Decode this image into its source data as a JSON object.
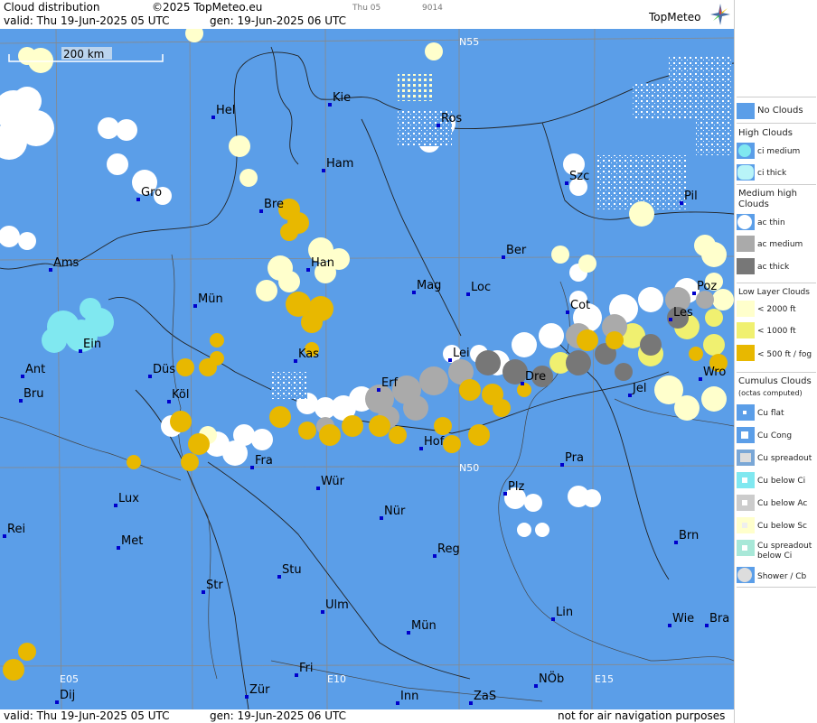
{
  "header": {
    "title": "Cloud distribution",
    "copyright": "©2025 TopMeteo.eu",
    "valid": "valid:  Thu  19-Jun-2025  05 UTC",
    "gen": "gen: 19-Jun-2025 06 UTC",
    "day_code": "Thu 05",
    "num_code": "9014",
    "logo": "TopMeteo"
  },
  "footer": {
    "valid": "valid:  Thu  19-Jun-2025  05 UTC",
    "gen": "gen: 19-Jun-2025 06 UTC",
    "disclaimer": "not for air navigation purposes"
  },
  "scale_bar": "200 km",
  "grid_labels": [
    "N55",
    "N50",
    "E05",
    "E10",
    "E15"
  ],
  "cities": [
    "Hel",
    "Kie",
    "Ros",
    "Ham",
    "Szc",
    "Gro",
    "Bre",
    "Pil",
    "Ams",
    "Han",
    "Ber",
    "Poz",
    "Mün",
    "Mag",
    "Loc",
    "Cot",
    "Les",
    "Ein",
    "Lei",
    "Ant",
    "Düs",
    "Kas",
    "Dre",
    "Wro",
    "Bru",
    "Köl",
    "Erf",
    "Jel",
    "Hof",
    "Fra",
    "Pra",
    "Würz",
    "Plz",
    "Lux",
    "Nür",
    "Rei",
    "Met",
    "Reg",
    "Brn",
    "Stu",
    "Str",
    "Ulm",
    "Lin",
    "Wie",
    "Bra",
    "Mün2",
    "Fri",
    "Dij",
    "Zür",
    "Inn",
    "ZaS",
    "NÖb"
  ],
  "city_names": {
    "Hel": "Hel",
    "Kie": "Kie",
    "Ros": "Ros",
    "Ham": "Ham",
    "Szc": "Szc",
    "Gro": "Gro",
    "Bre": "Bre",
    "Pil": "Pil",
    "Ams": "Ams",
    "Han": "Han",
    "Ber": "Ber",
    "Poz": "Poz",
    "Mün": "Mün",
    "Mag": "Mag",
    "Loc": "Loc",
    "Cot": "Cot",
    "Les": "Les",
    "Ein": "Ein",
    "Lei": "Lei",
    "Ant": "Ant",
    "Düs": "Düs",
    "Kas": "Kas",
    "Dre": "Dre",
    "Wro": "Wro",
    "Bru": "Bru",
    "Köl": "Köl",
    "Erf": "Erf",
    "Jel": "Jel",
    "Hof": "Hof",
    "Fra": "Fra",
    "Pra": "Pra",
    "Würz": "Wür",
    "Plz": "Plz",
    "Lux": "Lux",
    "Nür": "Nür",
    "Rei": "Rei",
    "Met": "Met",
    "Reg": "Reg",
    "Brn": "Brn",
    "Stu": "Stu",
    "Str": "Str",
    "Ulm": "Ulm",
    "Lin": "Lin",
    "Wie": "Wie",
    "Bra": "Bra",
    "Mün2": "Mün",
    "Fri": "Fri",
    "Dij": "Dij",
    "Zür": "Zür",
    "Inn": "Inn",
    "ZaS": "ZaS",
    "NÖb": "NÖb"
  },
  "legend": {
    "no_clouds": "No Clouds",
    "high": "High Clouds",
    "ci_medium": "ci medium",
    "ci_thick": "ci thick",
    "medium_high_1": "Medium high",
    "medium_high_2": "Clouds",
    "ac_thin": "ac thin",
    "ac_medium": "ac medium",
    "ac_thick": "ac thick",
    "low": "Low Layer Clouds",
    "lt2000": "< 2000 ft",
    "lt1000": "< 1000 ft",
    "lt500": "< 500 ft / fog",
    "cumulus_1": "Cumulus Clouds",
    "cumulus_2": "(octas computed)",
    "cu_flat": "Cu flat",
    "cu_cong": "Cu Cong",
    "cu_spread": "Cu spreadout",
    "cu_below_ci": "Cu below Ci",
    "cu_below_ac": "Cu below Ac",
    "cu_below_sc": "Cu below Sc",
    "cu_spread_ci_1": "Cu spreadout",
    "cu_spread_ci_2": "below Ci",
    "shower": "Shower / Cb"
  },
  "colors": {
    "sea_land": "#5b9ee8",
    "white_cloud": "#ffffff",
    "ac_medium": "#aaaaaa",
    "ac_thick": "#777777",
    "low_2000": "#ffffcc",
    "low_1000": "#f0f070",
    "fog": "#e8b800",
    "ci": "#80e8f0"
  }
}
